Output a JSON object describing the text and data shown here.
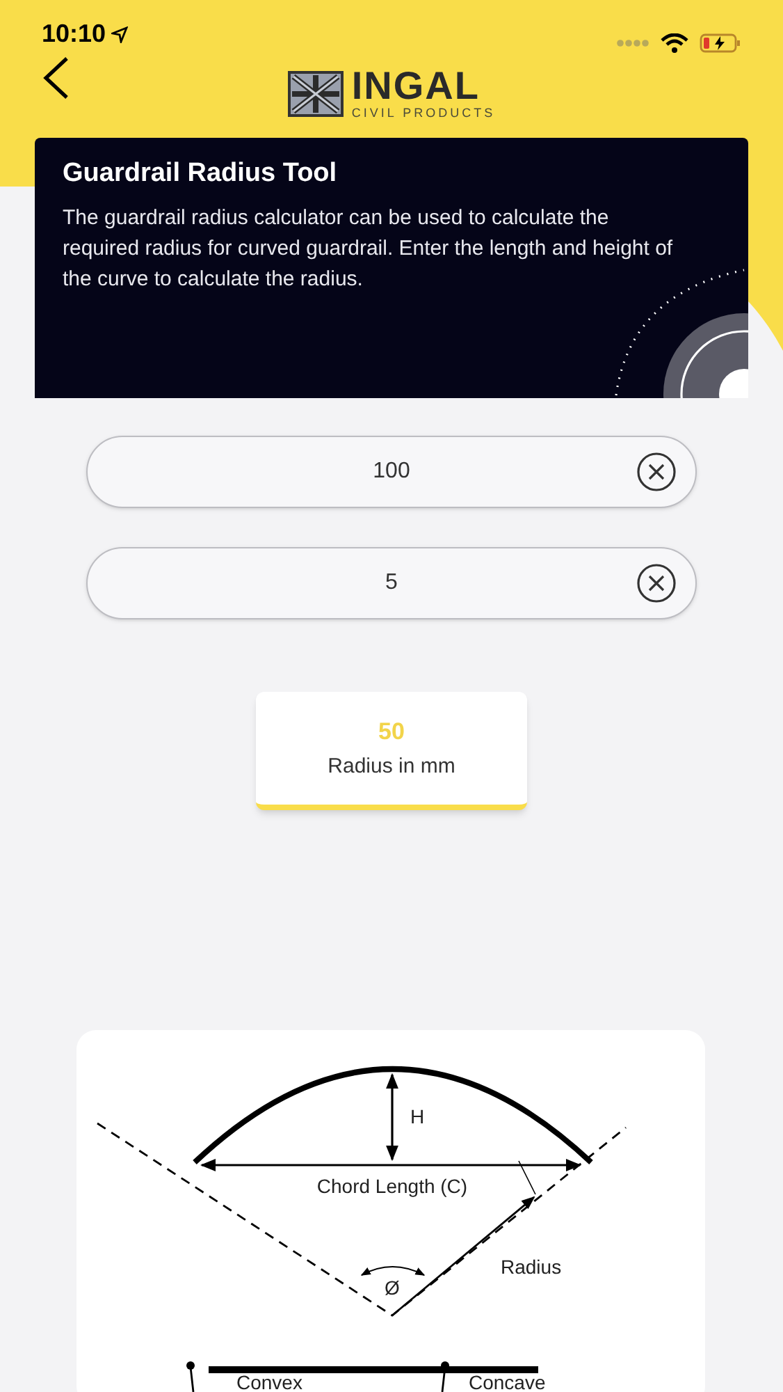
{
  "status_bar": {
    "time": "10:10"
  },
  "header": {
    "brand": "INGAL",
    "tagline": "CIVIL PRODUCTS"
  },
  "info_card": {
    "title": "Guardrail Radius Tool",
    "description": "The guardrail radius calculator can be used to calculate the required radius for curved guardrail. Enter the length and height of the curve to calculate the radius."
  },
  "inputs": [
    {
      "value": "100"
    },
    {
      "value": "5"
    }
  ],
  "result": {
    "value": "50",
    "label": "Radius in mm"
  },
  "diagram": {
    "labels": {
      "height": "H",
      "chord": "Chord Length (C)",
      "angle": "Ø",
      "radius": "Radius",
      "convex": "Convex",
      "concave": "Concave"
    }
  }
}
